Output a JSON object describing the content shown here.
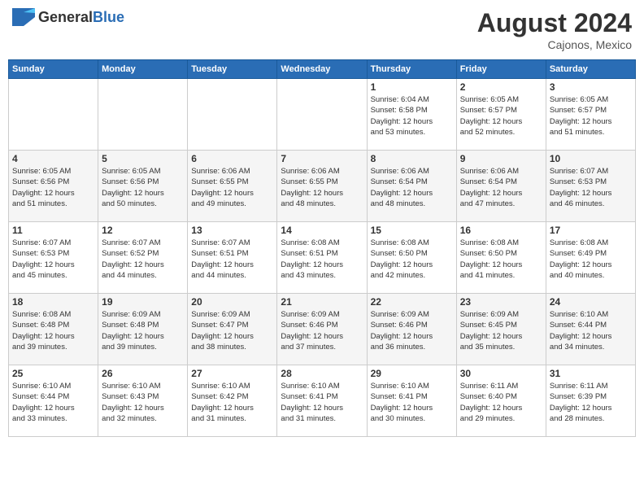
{
  "header": {
    "logo_general": "General",
    "logo_blue": "Blue",
    "month_year": "August 2024",
    "location": "Cajonos, Mexico"
  },
  "weekdays": [
    "Sunday",
    "Monday",
    "Tuesday",
    "Wednesday",
    "Thursday",
    "Friday",
    "Saturday"
  ],
  "weeks": [
    [
      {
        "day": "",
        "info": ""
      },
      {
        "day": "",
        "info": ""
      },
      {
        "day": "",
        "info": ""
      },
      {
        "day": "",
        "info": ""
      },
      {
        "day": "1",
        "info": "Sunrise: 6:04 AM\nSunset: 6:58 PM\nDaylight: 12 hours\nand 53 minutes."
      },
      {
        "day": "2",
        "info": "Sunrise: 6:05 AM\nSunset: 6:57 PM\nDaylight: 12 hours\nand 52 minutes."
      },
      {
        "day": "3",
        "info": "Sunrise: 6:05 AM\nSunset: 6:57 PM\nDaylight: 12 hours\nand 51 minutes."
      }
    ],
    [
      {
        "day": "4",
        "info": "Sunrise: 6:05 AM\nSunset: 6:56 PM\nDaylight: 12 hours\nand 51 minutes."
      },
      {
        "day": "5",
        "info": "Sunrise: 6:05 AM\nSunset: 6:56 PM\nDaylight: 12 hours\nand 50 minutes."
      },
      {
        "day": "6",
        "info": "Sunrise: 6:06 AM\nSunset: 6:55 PM\nDaylight: 12 hours\nand 49 minutes."
      },
      {
        "day": "7",
        "info": "Sunrise: 6:06 AM\nSunset: 6:55 PM\nDaylight: 12 hours\nand 48 minutes."
      },
      {
        "day": "8",
        "info": "Sunrise: 6:06 AM\nSunset: 6:54 PM\nDaylight: 12 hours\nand 48 minutes."
      },
      {
        "day": "9",
        "info": "Sunrise: 6:06 AM\nSunset: 6:54 PM\nDaylight: 12 hours\nand 47 minutes."
      },
      {
        "day": "10",
        "info": "Sunrise: 6:07 AM\nSunset: 6:53 PM\nDaylight: 12 hours\nand 46 minutes."
      }
    ],
    [
      {
        "day": "11",
        "info": "Sunrise: 6:07 AM\nSunset: 6:53 PM\nDaylight: 12 hours\nand 45 minutes."
      },
      {
        "day": "12",
        "info": "Sunrise: 6:07 AM\nSunset: 6:52 PM\nDaylight: 12 hours\nand 44 minutes."
      },
      {
        "day": "13",
        "info": "Sunrise: 6:07 AM\nSunset: 6:51 PM\nDaylight: 12 hours\nand 44 minutes."
      },
      {
        "day": "14",
        "info": "Sunrise: 6:08 AM\nSunset: 6:51 PM\nDaylight: 12 hours\nand 43 minutes."
      },
      {
        "day": "15",
        "info": "Sunrise: 6:08 AM\nSunset: 6:50 PM\nDaylight: 12 hours\nand 42 minutes."
      },
      {
        "day": "16",
        "info": "Sunrise: 6:08 AM\nSunset: 6:50 PM\nDaylight: 12 hours\nand 41 minutes."
      },
      {
        "day": "17",
        "info": "Sunrise: 6:08 AM\nSunset: 6:49 PM\nDaylight: 12 hours\nand 40 minutes."
      }
    ],
    [
      {
        "day": "18",
        "info": "Sunrise: 6:08 AM\nSunset: 6:48 PM\nDaylight: 12 hours\nand 39 minutes."
      },
      {
        "day": "19",
        "info": "Sunrise: 6:09 AM\nSunset: 6:48 PM\nDaylight: 12 hours\nand 39 minutes."
      },
      {
        "day": "20",
        "info": "Sunrise: 6:09 AM\nSunset: 6:47 PM\nDaylight: 12 hours\nand 38 minutes."
      },
      {
        "day": "21",
        "info": "Sunrise: 6:09 AM\nSunset: 6:46 PM\nDaylight: 12 hours\nand 37 minutes."
      },
      {
        "day": "22",
        "info": "Sunrise: 6:09 AM\nSunset: 6:46 PM\nDaylight: 12 hours\nand 36 minutes."
      },
      {
        "day": "23",
        "info": "Sunrise: 6:09 AM\nSunset: 6:45 PM\nDaylight: 12 hours\nand 35 minutes."
      },
      {
        "day": "24",
        "info": "Sunrise: 6:10 AM\nSunset: 6:44 PM\nDaylight: 12 hours\nand 34 minutes."
      }
    ],
    [
      {
        "day": "25",
        "info": "Sunrise: 6:10 AM\nSunset: 6:44 PM\nDaylight: 12 hours\nand 33 minutes."
      },
      {
        "day": "26",
        "info": "Sunrise: 6:10 AM\nSunset: 6:43 PM\nDaylight: 12 hours\nand 32 minutes."
      },
      {
        "day": "27",
        "info": "Sunrise: 6:10 AM\nSunset: 6:42 PM\nDaylight: 12 hours\nand 31 minutes."
      },
      {
        "day": "28",
        "info": "Sunrise: 6:10 AM\nSunset: 6:41 PM\nDaylight: 12 hours\nand 31 minutes."
      },
      {
        "day": "29",
        "info": "Sunrise: 6:10 AM\nSunset: 6:41 PM\nDaylight: 12 hours\nand 30 minutes."
      },
      {
        "day": "30",
        "info": "Sunrise: 6:11 AM\nSunset: 6:40 PM\nDaylight: 12 hours\nand 29 minutes."
      },
      {
        "day": "31",
        "info": "Sunrise: 6:11 AM\nSunset: 6:39 PM\nDaylight: 12 hours\nand 28 minutes."
      }
    ]
  ]
}
